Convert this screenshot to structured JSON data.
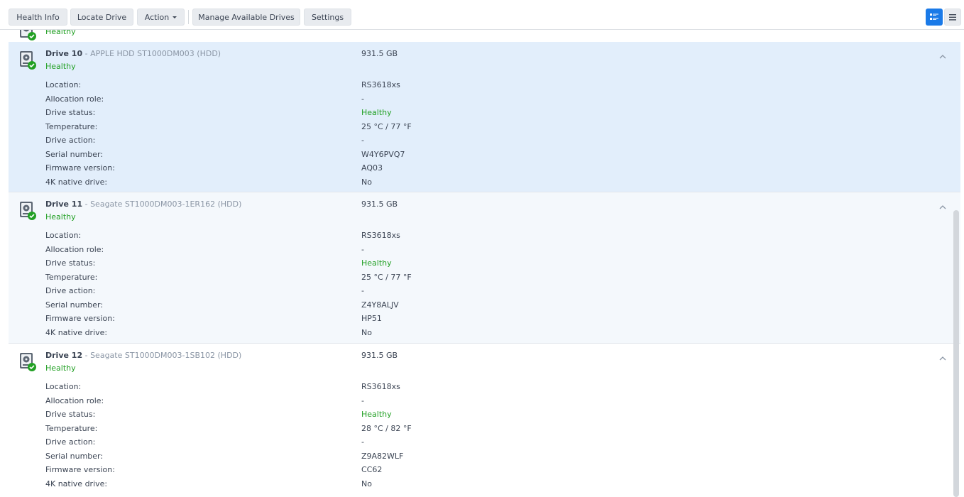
{
  "toolbar": {
    "health_info": "Health Info",
    "locate_drive": "Locate Drive",
    "action": "Action",
    "manage_drives": "Manage Available Drives",
    "settings": "Settings"
  },
  "partial_drive": {
    "health": "Healthy"
  },
  "fields": {
    "location": "Location:",
    "allocation_role": "Allocation role:",
    "drive_status": "Drive status:",
    "temperature": "Temperature:",
    "drive_action": "Drive action:",
    "serial_number": "Serial number:",
    "firmware_version": "Firmware version:",
    "native_4k": "4K native drive:"
  },
  "drives": [
    {
      "name": "Drive 10",
      "model": " - APPLE HDD ST1000DM003 (HDD)",
      "health": "Healthy",
      "size": "931.5 GB",
      "location": "RS3618xs",
      "allocation_role": "-",
      "drive_status": "Healthy",
      "temperature": "25 °C / 77 °F",
      "drive_action": "-",
      "serial_number": "W4Y6PVQ7",
      "firmware_version": "AQ03",
      "native_4k": "No"
    },
    {
      "name": "Drive 11",
      "model": " - Seagate ST1000DM003-1ER162 (HDD)",
      "health": "Healthy",
      "size": "931.5 GB",
      "location": "RS3618xs",
      "allocation_role": "-",
      "drive_status": "Healthy",
      "temperature": "25 °C / 77 °F",
      "drive_action": "-",
      "serial_number": "Z4Y8ALJV",
      "firmware_version": "HP51",
      "native_4k": "No"
    },
    {
      "name": "Drive 12",
      "model": " - Seagate ST1000DM003-1SB102 (HDD)",
      "health": "Healthy",
      "size": "931.5 GB",
      "location": "RS3618xs",
      "allocation_role": "-",
      "drive_status": "Healthy",
      "temperature": "28 °C / 82 °F",
      "drive_action": "-",
      "serial_number": "Z9A82WLF",
      "firmware_version": "CC62",
      "native_4k": "No"
    }
  ],
  "colors": {
    "accent": "#1a7ae8",
    "healthy": "#22a024",
    "selected_bg": "#e2eefb"
  }
}
